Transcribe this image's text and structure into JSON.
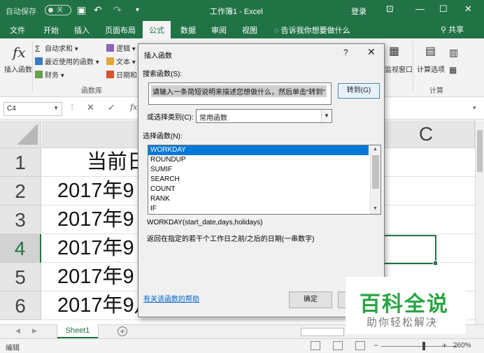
{
  "titlebar": {
    "autosave_label": "自动保存",
    "autosave_state": "关",
    "title": "工作簿1 - Excel",
    "login": "登录"
  },
  "ribbon_tabs": [
    "文件",
    "开始",
    "插入",
    "页面布局",
    "公式",
    "数据",
    "审阅",
    "视图"
  ],
  "active_tab": "公式",
  "tell_me": "告诉我你想要做什么",
  "share": "共享",
  "ribbon": {
    "insert_function": "插入函数",
    "autosum": "自动求和",
    "recent": "最近使用的函数",
    "financial": "财务",
    "logical": "逻辑",
    "text": "文本",
    "datetime": "日期和",
    "library_group": "函数库",
    "watch_window": "监视窗口",
    "calc_options": "计算选项",
    "calc_group": "计算"
  },
  "formula_bar": {
    "name_box": "C4",
    "fx": "fx"
  },
  "grid": {
    "columns": [
      "A",
      "C"
    ],
    "rows": [
      "1",
      "2",
      "3",
      "4",
      "5",
      "6"
    ],
    "cells": [
      "当前日",
      "2017年9",
      "2017年9",
      "2017年9",
      "2017年9",
      "2017年9月"
    ]
  },
  "sheet_tab": "Sheet1",
  "status": {
    "mode": "编辑",
    "zoom": "260%"
  },
  "dialog": {
    "title": "插入函数",
    "help": "?",
    "close": "✕",
    "search_label": "搜索函数(S):",
    "search_value": "请输入一条简短说明来描述您想做什么，然后单击“转到”",
    "go_button": "转到(G)",
    "category_label": "或选择类别(C):",
    "category_value": "常用函数",
    "select_label": "选择函数(N):",
    "functions": [
      "WORKDAY",
      "ROUNDUP",
      "SUMIF",
      "SEARCH",
      "COUNT",
      "RANK",
      "IF"
    ],
    "selected_function": "WORKDAY",
    "syntax": "WORKDAY(start_date,days,holidays)",
    "description": "返回在指定的若干个工作日之前/之后的日期(一串数字)",
    "help_link": "有关该函数的帮助",
    "ok_button": "确定",
    "cancel_button": "取消"
  },
  "watermark": {
    "main": "百科全说",
    "sub": "助你轻松解决"
  },
  "colors": {
    "excel_green": "#217346",
    "selection_blue": "#0078d7",
    "watermark_green": "#29a543"
  }
}
